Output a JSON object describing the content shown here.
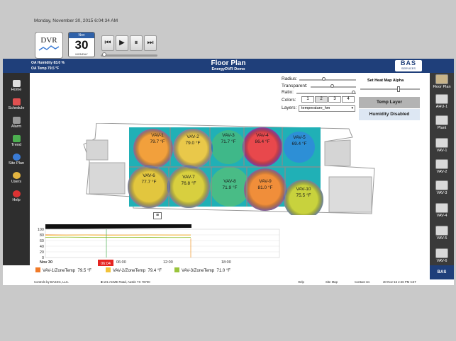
{
  "header": {
    "oa_humidity": "OA Humidity 83.0 %",
    "oa_temp": "OA Temp  79.5 °F",
    "title": "Floor Plan",
    "subtitle": "EnergyDVR Demo",
    "logo_main": "BAS",
    "logo_sub": "SERVICES"
  },
  "left_nav": [
    {
      "label": "Home",
      "icon": "home-icon"
    },
    {
      "label": "Schedule",
      "icon": "schedule-icon"
    },
    {
      "label": "Alarm",
      "icon": "alarm-icon"
    },
    {
      "label": "Trend",
      "icon": "trend-icon"
    },
    {
      "label": "Site Plan",
      "icon": "site-plan-icon"
    },
    {
      "label": "Users",
      "icon": "users-icon"
    },
    {
      "label": "Help",
      "icon": "help-icon"
    }
  ],
  "right_nav": [
    {
      "label": "Floor Plan"
    },
    {
      "label": "AHU-1"
    },
    {
      "label": "Plant"
    },
    {
      "label": "VAV-1"
    },
    {
      "label": "VAV-2"
    },
    {
      "label": "VAV-3"
    },
    {
      "label": "VAV-4"
    },
    {
      "label": "VAV-5"
    },
    {
      "label": "VAV-6"
    }
  ],
  "right_nav_bottom": "BAS",
  "timestamp": "Monday, November 30, 2015 6:04:34 AM",
  "dvr_label": "DVR",
  "calendar": {
    "month_header": "Nov",
    "day": "30",
    "footer": "MONDAY"
  },
  "playback": {
    "buttons": [
      "⏮",
      "▶",
      "⏸",
      "⏭"
    ],
    "position": 0.02
  },
  "heatmap_controls": {
    "radius_label": "Radius:",
    "radius_value": 0.45,
    "transparent_label": "Transparent:",
    "transparent_value": 0.6,
    "ratio_label": "Ratio:",
    "ratio_value": 0.95,
    "colors_label": "Colors:",
    "colors_options": [
      "1",
      "2",
      "3",
      "4"
    ],
    "colors_selected": "2",
    "layers_label": "Layers:",
    "layers_value": "temperature_hm",
    "alpha_label": "Set Heat Map Alpha",
    "alpha_value": 0.62,
    "temp_layer_btn": "Temp Layer",
    "humidity_btn": "Humidity Disabled"
  },
  "zones": [
    {
      "name": "VAV-1",
      "temp": "79.7 °F",
      "color": "#f2a03c"
    },
    {
      "name": "VAV-2",
      "temp": "79.0 °F",
      "color": "#e9c84a"
    },
    {
      "name": "VAV-3",
      "temp": "71.7 °F",
      "color": "#3fb889"
    },
    {
      "name": "VAV-4",
      "temp": "86.4 °F",
      "color": "#e8484c"
    },
    {
      "name": "VAV-5",
      "temp": "69.4 °F",
      "color": "#2d8fd6"
    },
    {
      "name": "VAV-6",
      "temp": "77.7 °F",
      "color": "#e2c63e"
    },
    {
      "name": "VAV-7",
      "temp": "76.8 °F",
      "color": "#d8cf3f"
    },
    {
      "name": "VAV-8",
      "temp": "71.9 °F",
      "color": "#49bc86"
    },
    {
      "name": "VAV-9",
      "temp": "81.0 °F",
      "color": "#f08e3a"
    },
    {
      "name": "VAV-10",
      "temp": "75.5 °F",
      "color": "#c8d23d"
    }
  ],
  "chart_data": {
    "type": "line",
    "title": "",
    "ylim": [
      0,
      100
    ],
    "yticks": [
      "100",
      "80",
      "60",
      "40",
      "20",
      "0"
    ],
    "x_labels": [
      "Nov 30",
      "06:00",
      "12:00",
      "18:00"
    ],
    "cursor_label": "06:04",
    "series": [
      {
        "name": "VAV-1/ZoneTemp",
        "color": "#f07a28",
        "values": [
          80,
          79.6,
          79.8,
          79.4,
          79.5,
          79.7,
          79.5,
          79.5
        ]
      },
      {
        "name": "VAV-2/ZoneTemp",
        "color": "#f2c33a",
        "values": [
          78.8,
          79.2,
          79.5,
          79.0,
          79.3,
          79.6,
          79.4,
          79.4
        ]
      },
      {
        "name": "VAV-3/ZoneTemp",
        "color": "#9ac43c",
        "values": [
          71.5,
          71.9,
          71.2,
          71.4,
          71.0,
          71.3,
          70.8,
          71.0
        ]
      }
    ],
    "legend": [
      {
        "label": "VAV-1/ZoneTemp",
        "value": "79.5 °F",
        "color": "#f07a28"
      },
      {
        "label": "VAV-2/ZoneTemp",
        "value": "79.4 °F",
        "color": "#f2c33a"
      },
      {
        "label": "VAV-3/ZoneTemp",
        "value": "71.0 °F",
        "color": "#9ac43c"
      }
    ]
  },
  "footer": {
    "controls": "Controls by BASSG, LLC.",
    "address": "■ 101 ACME Road, Austin TX 78700",
    "help": "Help",
    "site_map": "Site Map",
    "contact": "Contact Us",
    "datetime": "30-Nov-15 2:46 PM CST"
  }
}
